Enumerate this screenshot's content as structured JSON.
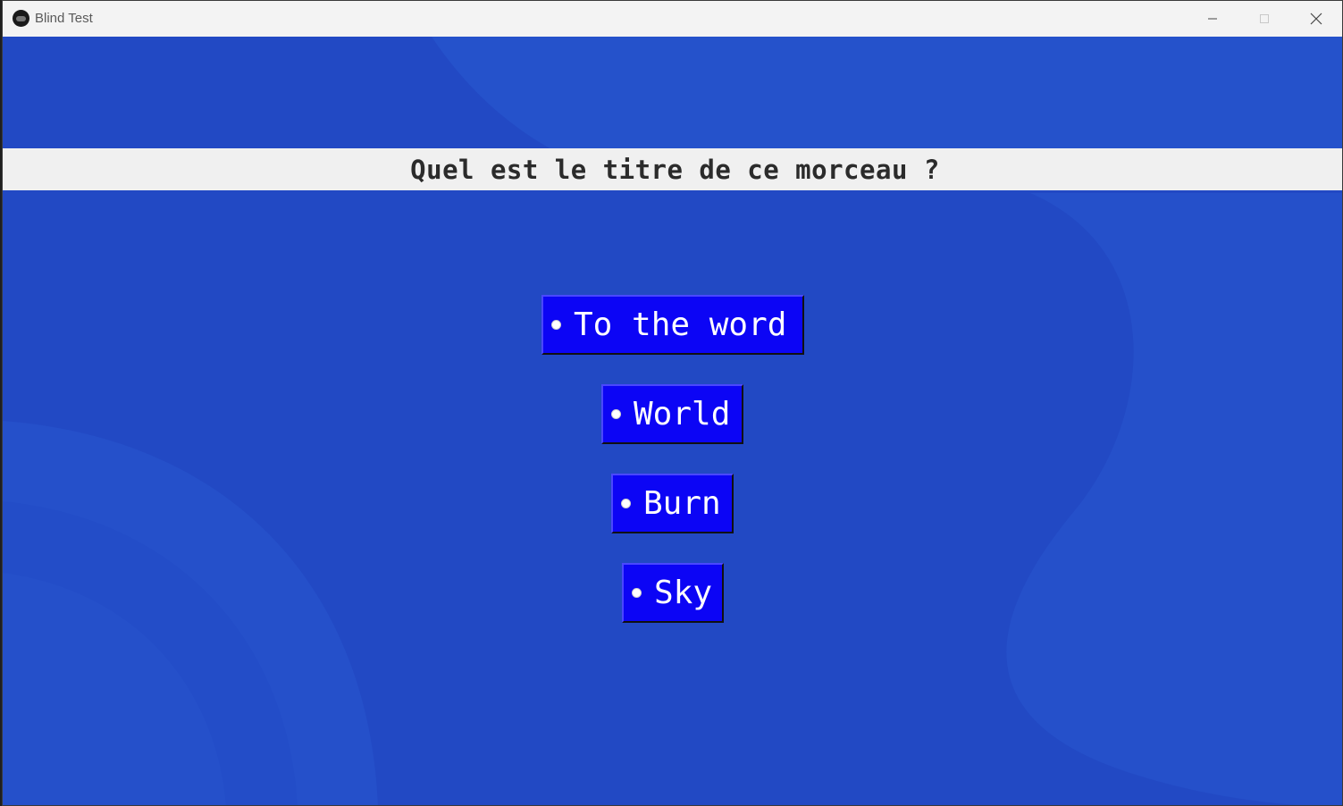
{
  "window": {
    "title": "Blind Test",
    "background_color": "#2352c9",
    "controls": {
      "minimize": "minimize-icon",
      "maximize": "maximize-icon",
      "close": "close-icon"
    }
  },
  "question": {
    "text": "Quel est le titre de ce morceau ?"
  },
  "choices": [
    {
      "label": "To the word"
    },
    {
      "label": "World"
    },
    {
      "label": "Burn"
    },
    {
      "label": "Sky"
    }
  ],
  "colors": {
    "choice_background": "#0c05f5",
    "choice_text": "#ffffff",
    "question_bar": "#f0f0f0"
  }
}
